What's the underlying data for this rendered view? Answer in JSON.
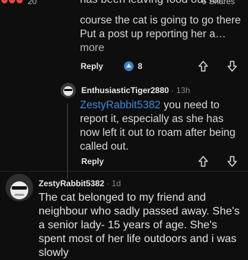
{
  "top": {
    "status_number": "20",
    "share_count": "6 Shares",
    "cut_text": "has been leaving food out for"
  },
  "comment1": {
    "text_visible": "course the cat is going to go there Put a post up reporting her a…",
    "more_label": "more",
    "reply_label": "Reply",
    "award_count": "8"
  },
  "comment2": {
    "author": "EnthusiasticTiger2880",
    "age": "13h",
    "mention": "ZestyRabbit5382",
    "text": " you need to report it, especially as she has now left it out to roam after being called out.",
    "reply_label": "Reply"
  },
  "comment3": {
    "author": "ZestyRabbit5382",
    "age": "1d",
    "text": "The cat belonged to my friend and neighbour who sadly passed away. She's a senior lady- 15 years of age. She's spent most of her life outdoors and i was slowly"
  },
  "separator": "·",
  "colors": {
    "accent_link": "#3b8ad9",
    "background": "#0e0e0e",
    "text": "#e6e6e6"
  }
}
